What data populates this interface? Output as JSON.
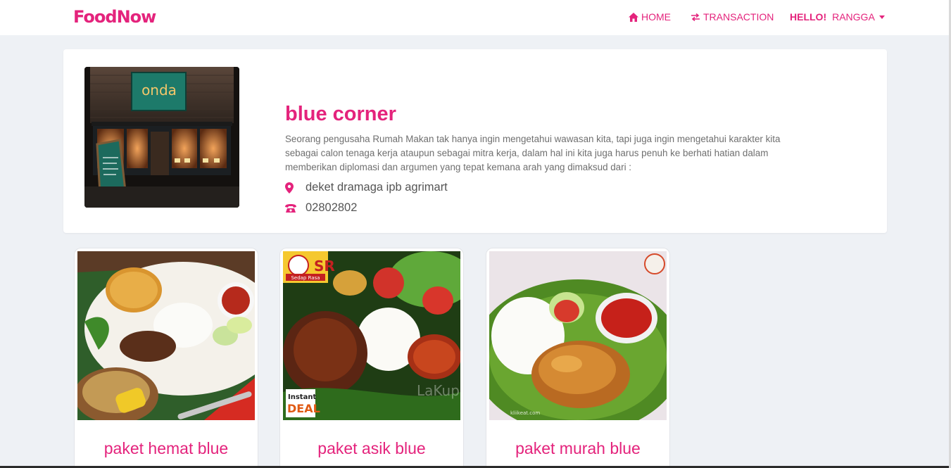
{
  "brand": "FoodNow",
  "nav": {
    "home": "HOME",
    "transaction": "TRANSACTION",
    "hello": "HELLO!",
    "user": "RANGGA"
  },
  "restaurant": {
    "name": "blue corner",
    "description": "Seorang pengusaha Rumah Makan tak hanya ingin mengetahui wawasan kita, tapi juga ingin mengetahui karakter kita sebagai calon tenaga kerja ataupun sebagai mitra kerja, dalam hal ini kita juga harus penuh ke berhati hatian dalam memberikan diplomasi dan argumen yang tepat kemana arah yang dimaksud dari :",
    "address": "deket dramaga ipb agrimart",
    "phone": "02802802",
    "sign_text": "onda"
  },
  "menu": [
    {
      "name": "paket hemat blue"
    },
    {
      "name": "paket asik blue",
      "badge_top": "SR",
      "badge_sub": "Sedap Rasa",
      "badge_instant": "Instant",
      "badge_deal": "DEAL",
      "watermark": "LaKup"
    },
    {
      "name": "paket murah blue",
      "watermark": "kliikeat.com"
    }
  ],
  "colors": {
    "accent": "#e4237c",
    "background": "#eef1f5"
  }
}
